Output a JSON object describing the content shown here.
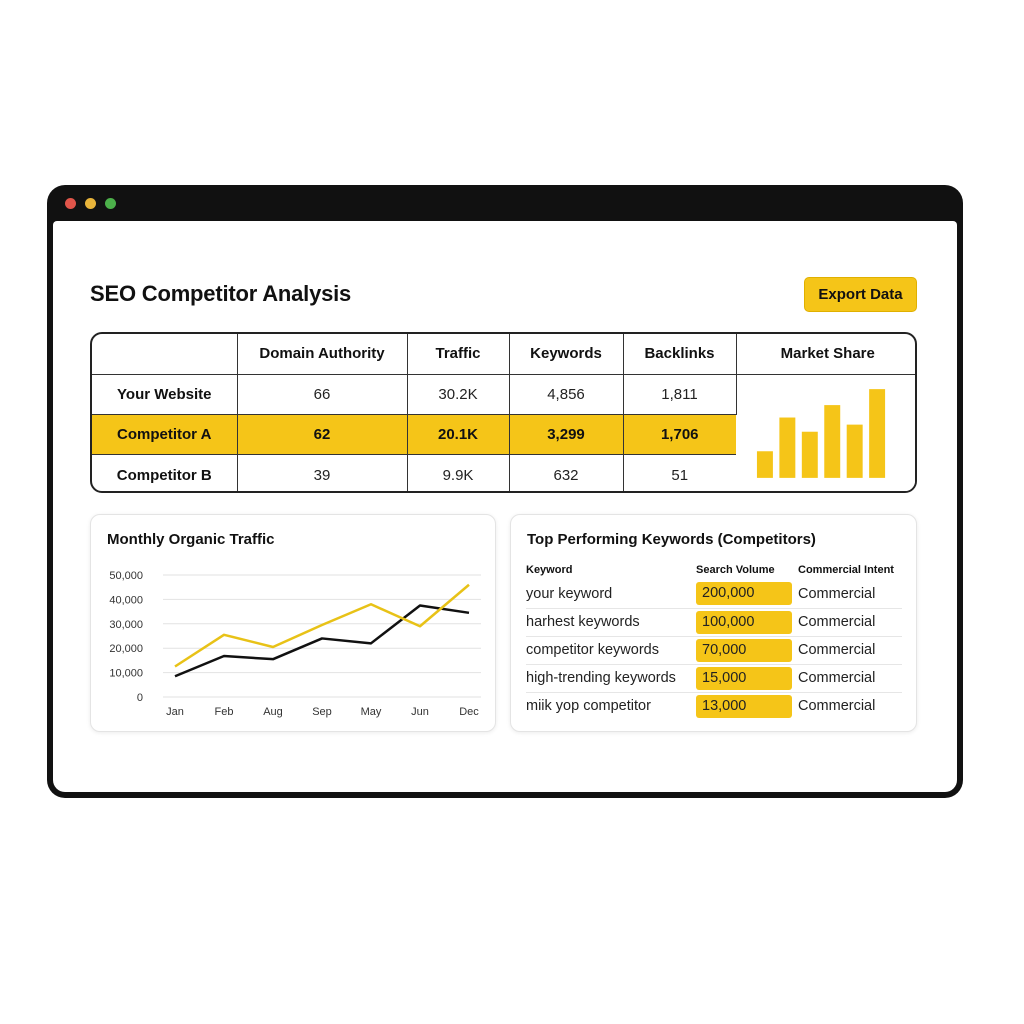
{
  "window": {
    "controls": [
      "close",
      "minimize",
      "maximize"
    ]
  },
  "header": {
    "title": "SEO Competitor Analysis",
    "export_label": "Export Data"
  },
  "competitor_table": {
    "columns": [
      "",
      "Domain Authority",
      "Traffic",
      "Keywords",
      "Backlinks",
      "Market Share"
    ],
    "rows": [
      {
        "name": "Your Website",
        "domain_authority": "66",
        "traffic": "30.2K",
        "keywords": "4,856",
        "backlinks": "1,811"
      },
      {
        "name": "Competitor A",
        "domain_authority": "62",
        "traffic": "20.1K",
        "keywords": "3,299",
        "backlinks": "1,706"
      },
      {
        "name": "Competitor B",
        "domain_authority": "39",
        "traffic": "9.9K",
        "keywords": "632",
        "backlinks": "51"
      }
    ],
    "highlighted_row": "Competitor A",
    "highlight_color": "#f5c518"
  },
  "chart_data": [
    {
      "type": "bar",
      "title": "Market Share",
      "categories": [
        "1",
        "2",
        "3",
        "4",
        "5",
        "6"
      ],
      "values": [
        30,
        68,
        52,
        82,
        60,
        100
      ],
      "ylim": [
        0,
        100
      ],
      "color": "#f5c518"
    },
    {
      "type": "line",
      "title": "Monthly Organic Traffic",
      "x": [
        "Jan",
        "Feb",
        "Aug",
        "Sep",
        "May",
        "June",
        "Dec"
      ],
      "x_labels": [
        "Jan",
        "Feb",
        "Aug",
        "Sep",
        "May",
        "Jun",
        "Dec"
      ],
      "ylim": [
        0,
        50000
      ],
      "y_ticks": [
        "0",
        "10,000",
        "20,000",
        "30,000",
        "40,000",
        "50,000"
      ],
      "grid": true,
      "series": [
        {
          "color": "#111111",
          "values": [
            8500,
            16800,
            15500,
            24000,
            22000,
            37500,
            34500
          ]
        },
        {
          "color": "#e8c217",
          "values": [
            12500,
            25500,
            20500,
            29500,
            38000,
            29000,
            46000
          ]
        }
      ]
    }
  ],
  "keywords_panel": {
    "title": "Top Performing Keywords (Competitors)",
    "headers": [
      "Keyword",
      "Search Volume",
      "Commercial Intent"
    ],
    "rows": [
      {
        "keyword": "your keyword",
        "volume": "200,000",
        "intent": "Commercial"
      },
      {
        "keyword": "harhest keywords",
        "volume": "100,000",
        "intent": "Commercial"
      },
      {
        "keyword": "competitor keywords",
        "volume": "70,000",
        "intent": "Commercial"
      },
      {
        "keyword": "high-trending keywords",
        "volume": "15,000",
        "intent": "Commercial"
      },
      {
        "keyword": "miik yop competitor",
        "volume": "13,000",
        "intent": "Commercial"
      }
    ]
  }
}
